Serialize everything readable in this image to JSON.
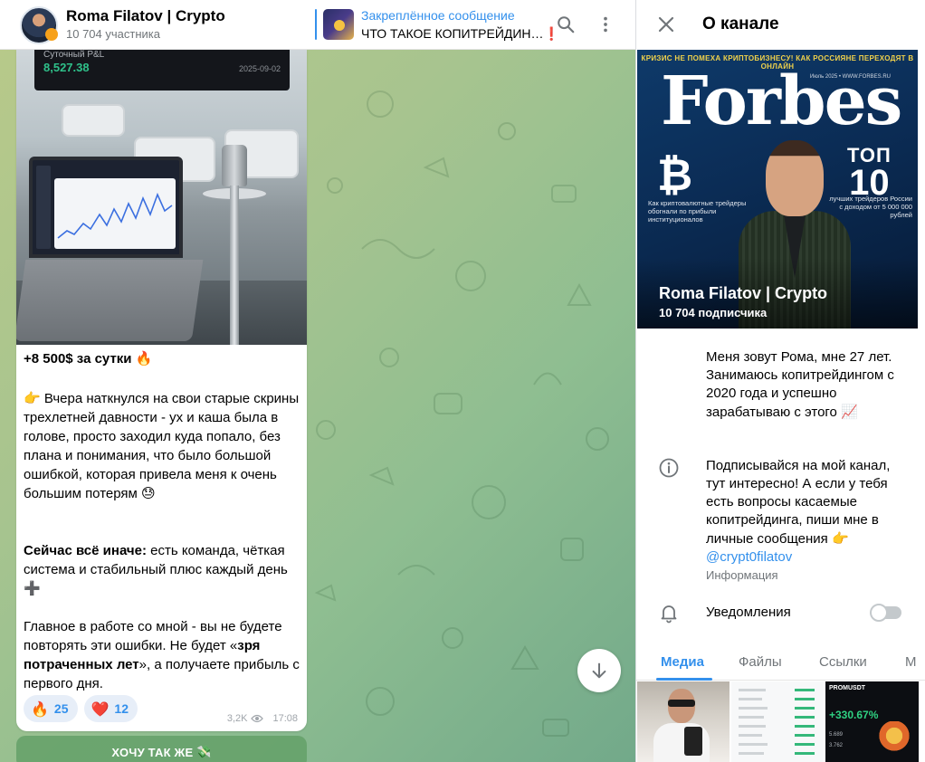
{
  "header": {
    "channel_title": "Roma Filatov | Crypto",
    "members": "10 704 участника",
    "pinned_title": "Закреплённое сообщение",
    "pinned_text": "ЧТО ТАКОЕ КОПИТРЕЙДИН…",
    "pinned_emoji": "❗"
  },
  "message": {
    "photo": {
      "pnl_label": "Суточный P&L",
      "pnl_value": "8,527.38",
      "pnl_date": "2025-09-02"
    },
    "headline": "+8 500$ за сутки",
    "headline_emoji": "🔥",
    "p1_emoji": "👉",
    "p1": "Вчера наткнулся на свои старые скрины трехлетней давности - ух и каша была в голове, просто заходил куда попало, без плана и понимания, что было большой ошибкой, которая привела меня к очень большим потерям",
    "p1_end_emoji": "😓",
    "p2_bold": "Сейчас всё иначе:",
    "p2": " есть команда, чёткая система и стабильный плюс каждый день",
    "p2_emoji": "➕",
    "p3_a": "Главное в работе со мной - вы не будете повторять эти ошибки. Не будет «",
    "p3_bold": "зря потраченных лет",
    "p3_b": "», а получаете прибыль с первого дня.",
    "reactions": [
      {
        "emoji": "🔥",
        "count": "25"
      },
      {
        "emoji": "❤️",
        "count": "12"
      }
    ],
    "views": "3,2K",
    "time": "17:08",
    "cta_label": "ХОЧУ ТАК ЖЕ",
    "cta_emoji": "💸"
  },
  "panel": {
    "title": "О канале",
    "cover": {
      "strap": "КРИЗИС НЕ ПОМЕХА КРИПТОБИЗНЕСУ! КАК РОССИЯНЕ ПЕРЕХОДЯТ В ОНЛАЙН",
      "date": "Июль 2025 • WWW.FORBES.RU",
      "masthead": "Forbes",
      "btc_symbol": "₿",
      "btc_text": "Как криптовалютные трейдеры обогнали по прибыли институционалов",
      "top_label": "ТОП",
      "top_num": "10",
      "top_text": "лучших трейдеров России с доходом от 5 000 000 рублей",
      "name": "Roma Filatov | Crypto",
      "subscribers": "10 704 подписчика"
    },
    "desc1": "Меня зовут Рома, мне 27 лет. Занимаюсь копитрейдингом с 2020 года и успешно зарабатываю с этого",
    "desc1_emoji": "📈",
    "desc2": "Подписывайся на мой канал, тут интересно! А если у тебя есть вопросы касаемые копитрейдинга, пиши мне в личные сообщения",
    "desc2_emoji": "👉",
    "mention": "@crypt0filatov",
    "info_label": "Информация",
    "notifications_label": "Уведомления",
    "notifications_on": false,
    "tabs": [
      "Медиа",
      "Файлы",
      "Ссылки",
      "М"
    ],
    "media": {
      "m3_pair": "PROMUSDT",
      "m3_pct": "+330.67%",
      "m3_v1": "5.689",
      "m3_v2": "3.762"
    }
  },
  "colors": {
    "accent": "#3390ec",
    "secondary_text": "#707579",
    "profit_green": "#2fc08a"
  }
}
